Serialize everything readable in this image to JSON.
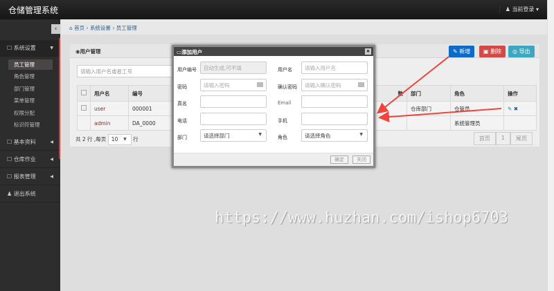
{
  "app": {
    "title": "仓储管理系统",
    "user_menu": "当前登录"
  },
  "sidebar": {
    "sections": [
      {
        "label": "系统设置",
        "items": [
          "员工管理",
          "角色管理",
          "部门管理",
          "菜单管理",
          "权限分配",
          "标识符管理"
        ]
      },
      {
        "label": "基本资料"
      },
      {
        "label": "仓库作业"
      },
      {
        "label": "报表管理"
      },
      {
        "label": "退出系统"
      }
    ]
  },
  "breadcrumb": [
    "首页",
    "系统设置",
    "员工管理"
  ],
  "panel": {
    "title": "用户管理",
    "buttons": {
      "add": "新增",
      "delete": "删除",
      "export": "导出"
    },
    "search_placeholder": "请输入用户名或者工号",
    "columns": [
      "用户名",
      "编号",
      "数",
      "部门",
      "角色",
      "操作"
    ],
    "rows": [
      {
        "username": "user",
        "code": "000001",
        "dept": "仓库部门",
        "role": "仓管员"
      },
      {
        "username": "admin",
        "code": "DA_0000",
        "dept": "",
        "role": "系统管理员"
      }
    ],
    "pager": {
      "total_prefix": "共 2 行 ,每页",
      "page_size": "10",
      "suffix": "行",
      "first": "首页",
      "current": "1",
      "last": "尾页"
    }
  },
  "modal": {
    "title": "添加用户",
    "fields": {
      "code_label": "用户编号",
      "code_value": "自动生成,可不填",
      "username_label": "用户名",
      "username_placeholder": "请输入用户名",
      "password_label": "密码",
      "password_placeholder": "请输入密码",
      "confirm_label": "确认密码",
      "confirm_placeholder": "请输入确认密码",
      "realname_label": "真名",
      "email_label": "Email",
      "phone_label": "电话",
      "mobile_label": "手机",
      "dept_label": "部门",
      "dept_value": "请选择部门",
      "role_label": "角色",
      "role_value": "请选择角色"
    },
    "ok": "确定",
    "close": "关闭"
  },
  "watermark": "https://www.huzhan.com/ishop6703",
  "colors": {
    "add": "#0d6ac8",
    "delete": "#d24a48",
    "export": "#3da6c0",
    "arrow": "#f0443c"
  }
}
